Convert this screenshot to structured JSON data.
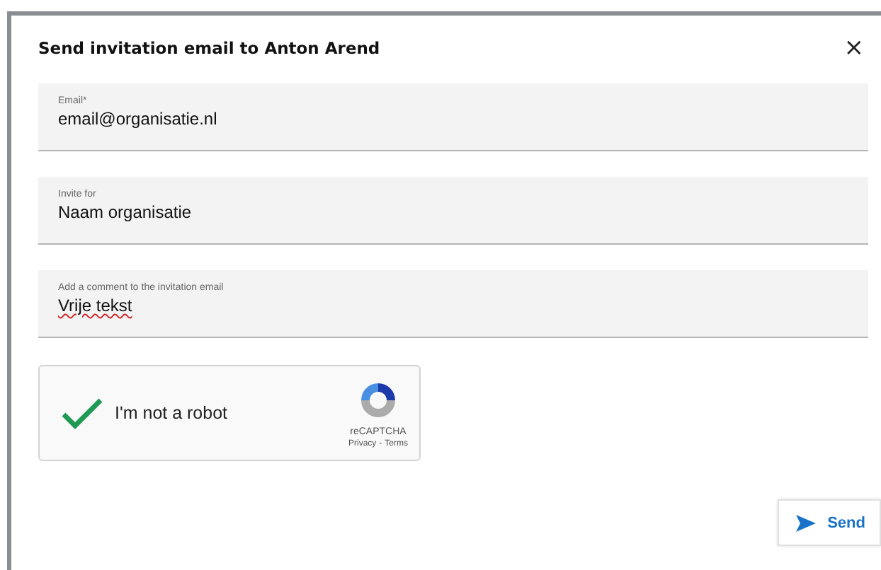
{
  "dialog": {
    "title": "Send invitation email to Anton Arend",
    "close": "×"
  },
  "fields": [
    {
      "label": "Email*",
      "value": "email@organisatie.nl",
      "misspelled": false
    },
    {
      "label": "Invite for",
      "value": "Naam organisatie",
      "misspelled": false
    },
    {
      "label": "Add a comment to the invitation email",
      "value": "Vrije tekst",
      "misspelled": true
    }
  ],
  "captcha": {
    "checked": true,
    "label": "I'm not a robot",
    "brand": "reCAPTCHA",
    "privacy": "Privacy",
    "separator": "-",
    "terms": "Terms"
  },
  "send_button": {
    "label": "Send"
  }
}
